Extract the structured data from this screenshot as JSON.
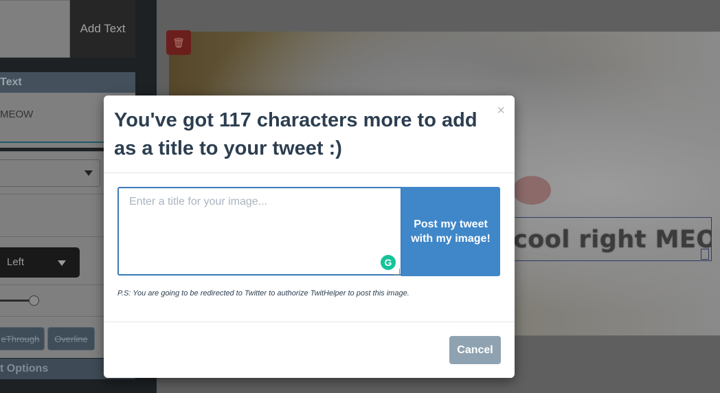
{
  "sidebar": {
    "add_text_label": "Add Text",
    "text_section_label": "Text",
    "text_input_value": "MEOW",
    "align_label": "Left",
    "line_through_label": "eThrough",
    "overline_label": "Overline",
    "options_section_label": "t Options"
  },
  "canvas": {
    "caption_text": "cool right MEOW"
  },
  "modal": {
    "title": "You've got 117 characters more to add as a title to your tweet :)",
    "close_symbol": "×",
    "input_placeholder": "Enter a title for your image...",
    "input_value": "",
    "post_button_label": "Post my tweet with my image!",
    "note": "P.S: You are going to be redirected to Twitter to authorize TwitHelper to post this image.",
    "cancel_button_label": "Cancel"
  },
  "colors": {
    "title": "#2c3e50",
    "primary_button": "#3f87c9",
    "cancel_button": "#8fa2b1",
    "grammarly": "#15c39a"
  }
}
